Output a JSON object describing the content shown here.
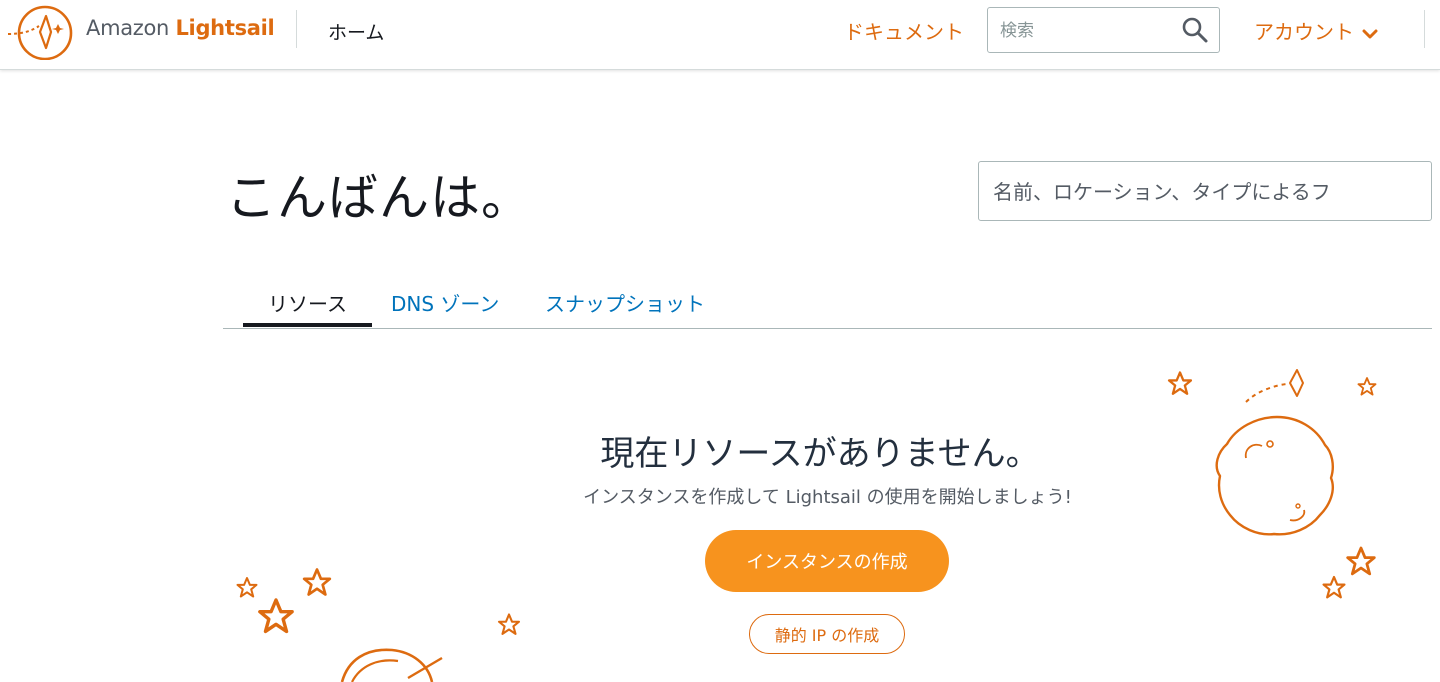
{
  "header": {
    "brand_prefix": "Amazon",
    "brand_name": "Lightsail",
    "home_link": "ホーム",
    "docs_link": "ドキュメント",
    "search_placeholder": "検索",
    "account_menu": "アカウント"
  },
  "main": {
    "greeting": "こんばんは。",
    "filter_placeholder": "名前、ロケーション、タイプによるフ",
    "tabs": [
      {
        "label": "リソース",
        "active": true
      },
      {
        "label": "DNS ゾーン",
        "active": false
      },
      {
        "label": "スナップショット",
        "active": false
      }
    ],
    "empty_state": {
      "title": "現在リソースがありません。",
      "subtitle": "インスタンスを作成して Lightsail の使用を開始しましょう!",
      "primary_button": "インスタンスの作成",
      "secondary_button": "静的 IP の作成"
    }
  },
  "colors": {
    "accent": "#dd6b10",
    "button": "#f7931e",
    "link": "#0073bb",
    "text": "#16191f"
  }
}
